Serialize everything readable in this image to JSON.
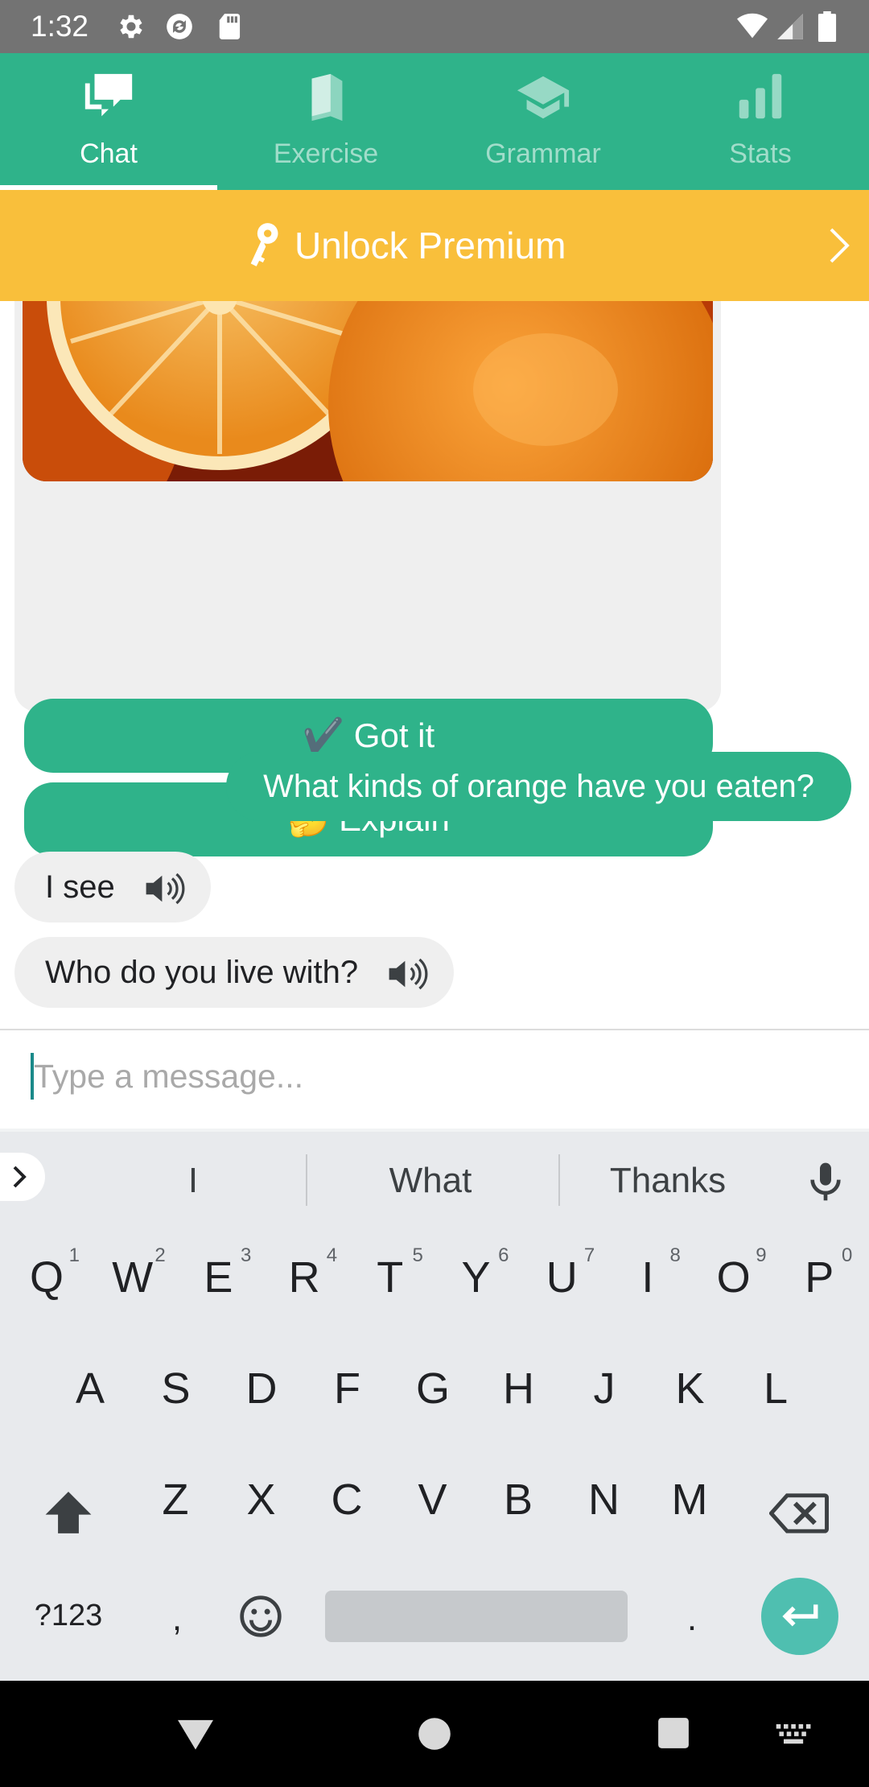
{
  "status_bar": {
    "time": "1:32"
  },
  "tabs": [
    {
      "label": "Chat",
      "icon": "chat-icon",
      "active": true
    },
    {
      "label": "Exercise",
      "icon": "book-icon",
      "active": false
    },
    {
      "label": "Grammar",
      "icon": "graduation-cap-icon",
      "active": false
    },
    {
      "label": "Stats",
      "icon": "bar-chart-icon",
      "active": false
    }
  ],
  "premium_banner": {
    "label": "Unlock Premium"
  },
  "card": {
    "got_it_label": "✔️ Got it",
    "explain_label": "🤔 Explain"
  },
  "messages": {
    "outgoing": "What kinds of orange have you eaten?",
    "incoming": [
      "I see",
      "Who do you live with?"
    ]
  },
  "composer": {
    "placeholder": "Type a message..."
  },
  "keyboard": {
    "suggestions": [
      "I",
      "What",
      "Thanks"
    ],
    "row1": [
      {
        "k": "Q",
        "n": "1"
      },
      {
        "k": "W",
        "n": "2"
      },
      {
        "k": "E",
        "n": "3"
      },
      {
        "k": "R",
        "n": "4"
      },
      {
        "k": "T",
        "n": "5"
      },
      {
        "k": "Y",
        "n": "6"
      },
      {
        "k": "U",
        "n": "7"
      },
      {
        "k": "I",
        "n": "8"
      },
      {
        "k": "O",
        "n": "9"
      },
      {
        "k": "P",
        "n": "0"
      }
    ],
    "row2": [
      "A",
      "S",
      "D",
      "F",
      "G",
      "H",
      "J",
      "K",
      "L"
    ],
    "row3": [
      "Z",
      "X",
      "C",
      "V",
      "B",
      "N",
      "M"
    ],
    "symbols_label": "?123",
    "comma": ",",
    "period": "."
  },
  "colors": {
    "brand_green": "#2fb38a",
    "premium_yellow": "#f9bf3b",
    "enter_teal": "#4fbfb0"
  }
}
